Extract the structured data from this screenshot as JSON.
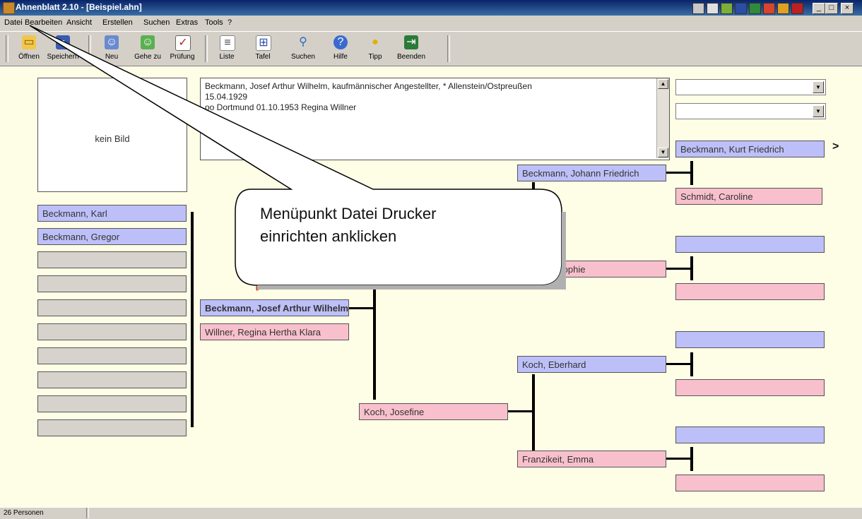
{
  "window": {
    "title": "Ahnenblatt 2.10 - [Beispiel.ahn]"
  },
  "menu": [
    {
      "label": "Datei"
    },
    {
      "label": "Bearbeiten"
    },
    {
      "label": "Ansicht"
    },
    {
      "label": "Erstellen"
    },
    {
      "label": "Suchen"
    },
    {
      "label": "Extras"
    },
    {
      "label": "Tools"
    },
    {
      "label": "?"
    }
  ],
  "toolbar": [
    {
      "label": "Öffnen",
      "icon": "folder-open-icon"
    },
    {
      "label": "Speichern",
      "icon": "save-icon"
    },
    {
      "label": "Neu",
      "icon": "new-person-icon"
    },
    {
      "label": "Gehe zu",
      "icon": "goto-person-icon"
    },
    {
      "label": "Prüfung",
      "icon": "check-icon"
    },
    {
      "label": "Liste",
      "icon": "list-icon"
    },
    {
      "label": "Tafel",
      "icon": "chart-icon"
    },
    {
      "label": "Suchen",
      "icon": "search-icon"
    },
    {
      "label": "Hilfe",
      "icon": "help-icon"
    },
    {
      "label": "Tipp",
      "icon": "tip-icon"
    },
    {
      "label": "Beenden",
      "icon": "exit-icon"
    }
  ],
  "photo": {
    "text": "kein Bild"
  },
  "info": {
    "line1": "Beckmann, Josef Arthur Wilhelm, kaufmännischer Angestellter, * Allenstein/Ostpreußen",
    "line2": "15.04.1929",
    "line3": "oo Dortmund 01.10.1953 Regina Willner"
  },
  "children": [
    "Beckmann, Karl",
    "Beckmann, Gregor",
    "",
    "",
    "",
    "",
    "",
    "",
    "",
    ""
  ],
  "person": {
    "name": "Beckmann, Josef Arthur Wilhelm",
    "spouse": "Willner, Regina Hertha Klara"
  },
  "parents": {
    "father": "Beckmann, Johann Friedrich",
    "mother": "Koch, Josefine"
  },
  "grandparents": {
    "pat_gm": "Sophie",
    "mat_gf": "Koch, Eberhard",
    "mat_gm": "Franzikeit, Emma"
  },
  "great_grandparents": {
    "g1": "Beckmann, Kurt Friedrich",
    "g2": "Schmidt, Caroline"
  },
  "more_arrow": ">",
  "callout": {
    "line1": "Menüpunkt Datei Drucker",
    "line2": "einrichten anklicken"
  },
  "status": {
    "count": "26 Personen"
  },
  "colors": {
    "male": "#bdc0f8",
    "female": "#f8c0cc",
    "empty": "#d7d3cc",
    "background": "#fefee6"
  }
}
